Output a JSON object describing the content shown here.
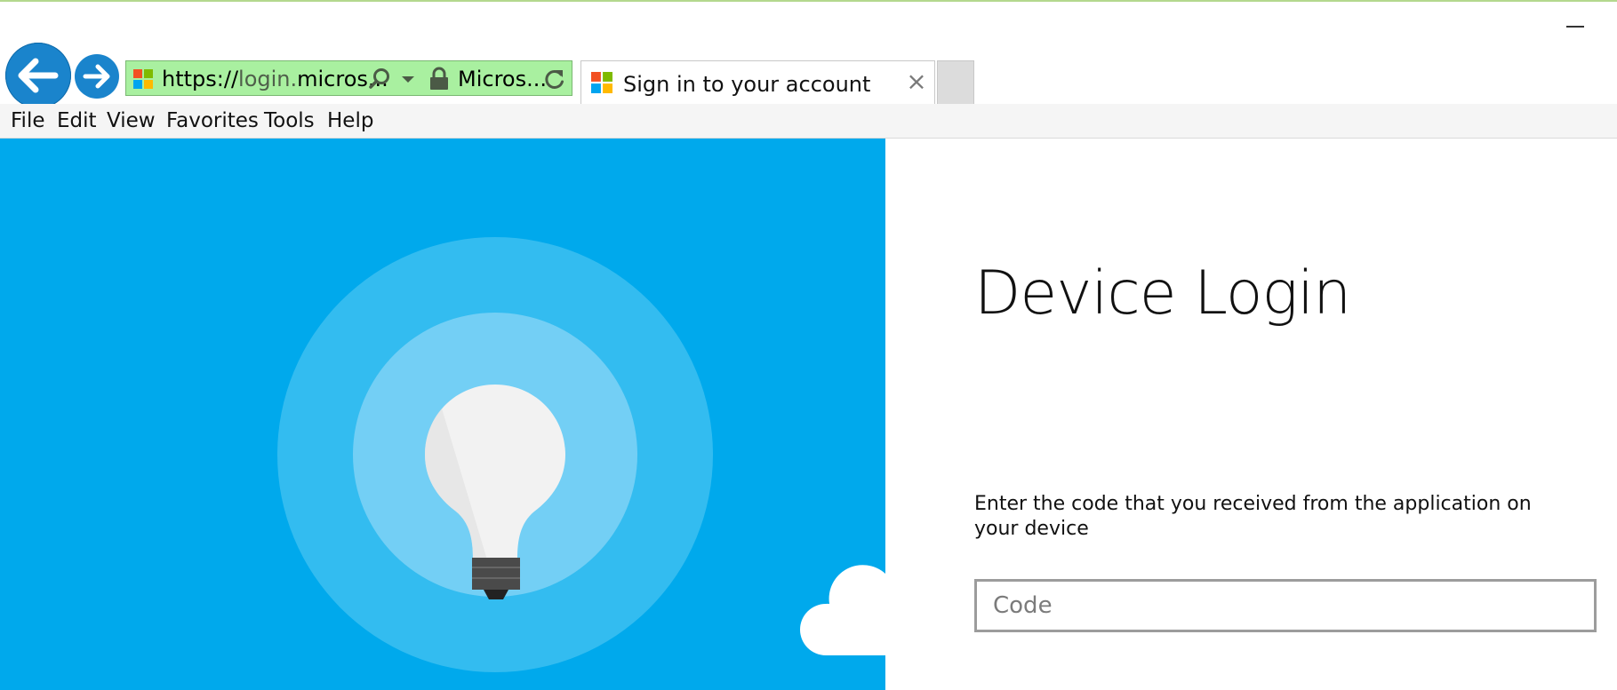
{
  "window": {
    "minimize_label": ""
  },
  "address_bar": {
    "url_prefix": "https://",
    "url_host_dim": "login.",
    "url_rest": "micros...",
    "cert_label": "Micros..."
  },
  "tab": {
    "title": "Sign in to your account",
    "close_glyph": "×"
  },
  "menu": {
    "items": [
      "File",
      "Edit",
      "View",
      "Favorites",
      "Tools",
      "Help"
    ]
  },
  "page": {
    "title": "Device Login",
    "description": "Enter the code that you received from the application on your device",
    "code_input": {
      "placeholder": "Code",
      "value": ""
    }
  },
  "colors": {
    "hero_blue": "#00a9ec",
    "address_bar_green": "#a9f0a0",
    "nav_button_blue": "#1a84cc"
  },
  "icons": {
    "back": "arrow-left-icon",
    "forward": "arrow-right-icon",
    "search": "search-icon",
    "dropdown": "chevron-down-icon",
    "lock": "lock-icon",
    "refresh": "refresh-icon",
    "site_logo": "microsoft-logo-icon",
    "close": "close-icon",
    "illustration": "lightbulb-illustration",
    "cloud": "cloud-illustration"
  }
}
